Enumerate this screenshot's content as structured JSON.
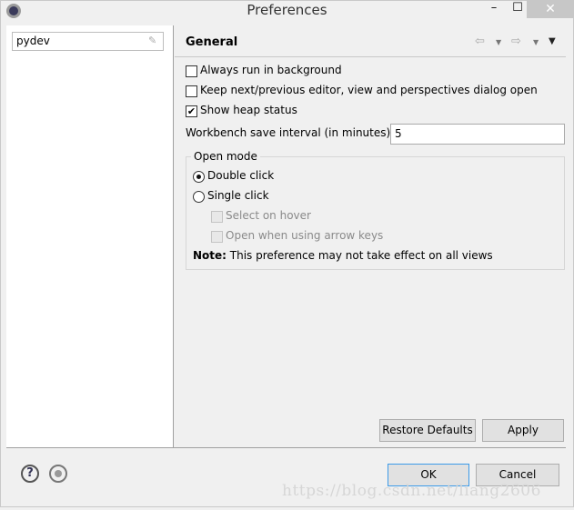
{
  "window": {
    "title": "Preferences",
    "minimize": "–",
    "maximize": "☐",
    "close": "✕"
  },
  "sidebar": {
    "filter_value": "pydev"
  },
  "page": {
    "title": "General"
  },
  "options": {
    "always_run_background": {
      "label": "Always run in background",
      "checked": false
    },
    "keep_next_prev": {
      "label": "Keep next/previous editor, view and perspectives dialog open",
      "checked": false
    },
    "show_heap": {
      "label": "Show heap status",
      "checked": true
    },
    "save_interval_label": "Workbench save interval (in minutes):",
    "save_interval_value": "5"
  },
  "open_mode": {
    "label": "Open mode",
    "double_click": "Double click",
    "single_click": "Single click",
    "selected": "Double click",
    "select_on_hover": "Select on hover",
    "open_arrow_keys": "Open when using arrow keys",
    "note_bold": "Note:",
    "note_text": " This preference may not take effect on all views"
  },
  "buttons": {
    "restore": "Restore Defaults",
    "apply": "Apply",
    "ok": "OK",
    "cancel": "Cancel",
    "help": "?"
  },
  "watermark": "https://blog.csdn.net/liang2606"
}
